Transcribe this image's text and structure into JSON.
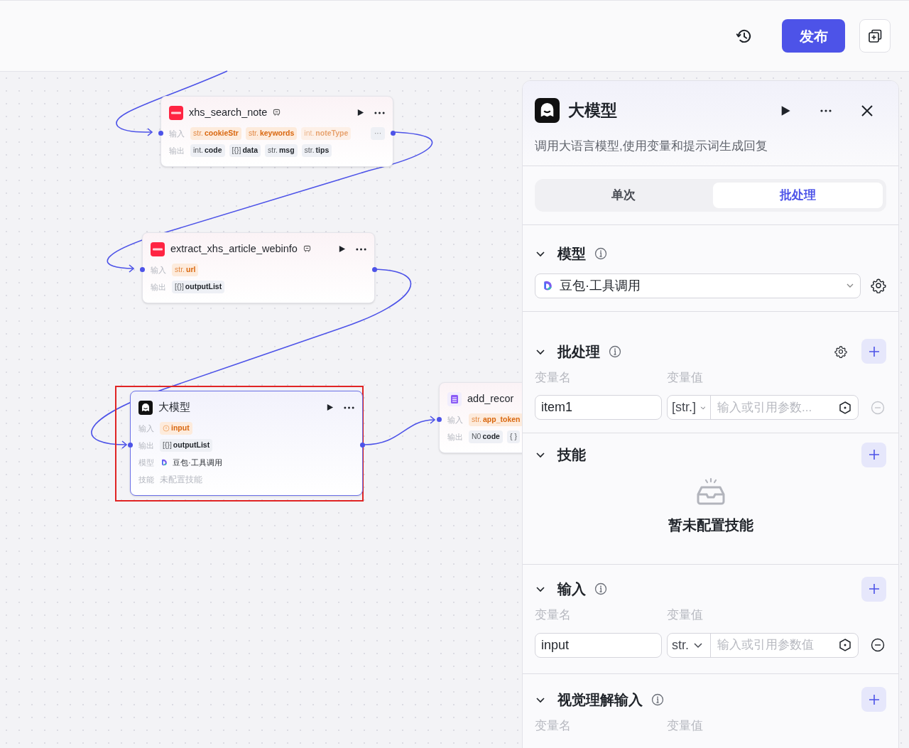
{
  "toolbar": {
    "publish_button": "发布"
  },
  "nodes": [
    {
      "kind": "plugin",
      "title": "xhs_search_note",
      "actions_visible": true,
      "selected": false,
      "highlighted": false,
      "rows": [
        {
          "label": "输入",
          "kind": "inputs",
          "more": "···",
          "tags": [
            {
              "type": "str.",
              "name": "cookieStr",
              "faded": false
            },
            {
              "type": "str.",
              "name": "keywords",
              "faded": false
            },
            {
              "type": "int.",
              "name": "noteType",
              "faded": true
            }
          ]
        },
        {
          "label": "输出",
          "kind": "outputs",
          "tags": [
            {
              "type": "int.",
              "name": "code",
              "faded": false
            },
            {
              "type": "[{}]",
              "name": "data",
              "faded": false
            },
            {
              "type": "str.",
              "name": "msg",
              "faded": false
            },
            {
              "type": "str.",
              "name": "tips",
              "faded": false
            }
          ]
        }
      ]
    },
    {
      "kind": "plugin",
      "title": "extract_xhs_article_webinfo",
      "actions_visible": true,
      "selected": false,
      "highlighted": false,
      "rows": [
        {
          "label": "输入",
          "kind": "inputs",
          "tags": [
            {
              "type": "str.",
              "name": "url",
              "faded": false
            }
          ]
        },
        {
          "label": "输出",
          "kind": "outputs",
          "tags": [
            {
              "type": "[{}]",
              "name": "outputList",
              "faded": false
            }
          ]
        }
      ]
    },
    {
      "kind": "llm",
      "title": "大模型",
      "actions_visible": true,
      "selected": true,
      "highlighted": true,
      "rows": [
        {
          "label": "输入",
          "kind": "inputs",
          "tags": [
            {
              "ref": true,
              "name": "input",
              "faded": false
            }
          ]
        },
        {
          "label": "输出",
          "kind": "outputs",
          "tags": [
            {
              "type": "[{}]",
              "name": "outputList",
              "faded": false
            }
          ]
        },
        {
          "label": "模型",
          "kind": "model",
          "text": "豆包·工具调用"
        },
        {
          "label": "技能",
          "kind": "muted",
          "text": "未配置技能"
        }
      ]
    },
    {
      "kind": "sheet",
      "title": "add_recor",
      "actions_visible": false,
      "selected": false,
      "highlighted": false,
      "rows": [
        {
          "label": "输入",
          "kind": "inputs",
          "tags": [
            {
              "type": "str.",
              "name": "app_token",
              "faded": false
            }
          ]
        },
        {
          "label": "输出",
          "kind": "outputs",
          "tags": [
            {
              "type": "N0",
              "name": "code",
              "faded": false
            },
            {
              "type": "{ }",
              "faded": false
            }
          ]
        }
      ]
    }
  ],
  "panel": {
    "title": "大模型",
    "description": "调用大语言模型,使用变量和提示词生成回复",
    "tabs": [
      {
        "label": "单次",
        "selected": false
      },
      {
        "label": "批处理",
        "selected": true
      }
    ],
    "sections": [
      {
        "kind": "model",
        "title": "模型",
        "info": true,
        "expanded": true,
        "model": "豆包·工具调用"
      },
      {
        "kind": "vars",
        "title": "批处理",
        "info": true,
        "settings": true,
        "add": true,
        "expanded": true,
        "name_header": "变量名",
        "value_header": "变量值",
        "rows": [
          {
            "name": "item1",
            "type": "[str.]",
            "placeholder": "输入或引用参数...",
            "remove_disabled": true
          }
        ]
      },
      {
        "kind": "skills",
        "title": "技能",
        "add": true,
        "expanded": true,
        "empty_text": "暂未配置技能"
      },
      {
        "kind": "vars",
        "title": "输入",
        "info": true,
        "add": true,
        "expanded": true,
        "name_header": "变量名",
        "value_header": "变量值",
        "rows": [
          {
            "name": "input",
            "type": "str.",
            "placeholder": "输入或引用参数值",
            "remove_disabled": false
          }
        ]
      },
      {
        "kind": "vars",
        "title": "视觉理解输入",
        "info": true,
        "add": true,
        "expanded": true,
        "name_header": "变量名",
        "value_header": "变量值"
      }
    ]
  }
}
